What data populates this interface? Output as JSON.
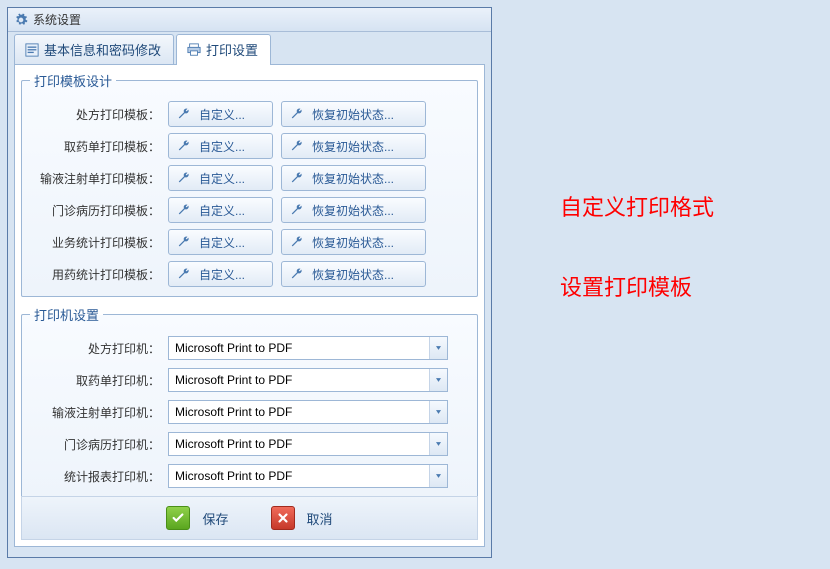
{
  "window": {
    "title": "系统设置"
  },
  "tabs": {
    "basic": "基本信息和密码修改",
    "print": "打印设置"
  },
  "templates": {
    "legend": "打印模板设计",
    "custom_label": "自定义...",
    "reset_label": "恢复初始状态...",
    "rows": [
      {
        "label": "处方打印模板："
      },
      {
        "label": "取药单打印模板："
      },
      {
        "label": "输液注射单打印模板："
      },
      {
        "label": "门诊病历打印模板："
      },
      {
        "label": "业务统计打印模板："
      },
      {
        "label": "用药统计打印模板："
      }
    ]
  },
  "printers": {
    "legend": "打印机设置",
    "rows": [
      {
        "label": "处方打印机：",
        "value": "Microsoft Print to PDF"
      },
      {
        "label": "取药单打印机：",
        "value": "Microsoft Print to PDF"
      },
      {
        "label": "输液注射单打印机：",
        "value": "Microsoft Print to PDF"
      },
      {
        "label": "门诊病历打印机：",
        "value": "Microsoft Print to PDF"
      },
      {
        "label": "统计报表打印机：",
        "value": "Microsoft Print to PDF"
      }
    ]
  },
  "footer": {
    "save": "保存",
    "cancel": "取消"
  },
  "annotations": {
    "line1": "自定义打印格式",
    "line2": "设置打印模板"
  }
}
